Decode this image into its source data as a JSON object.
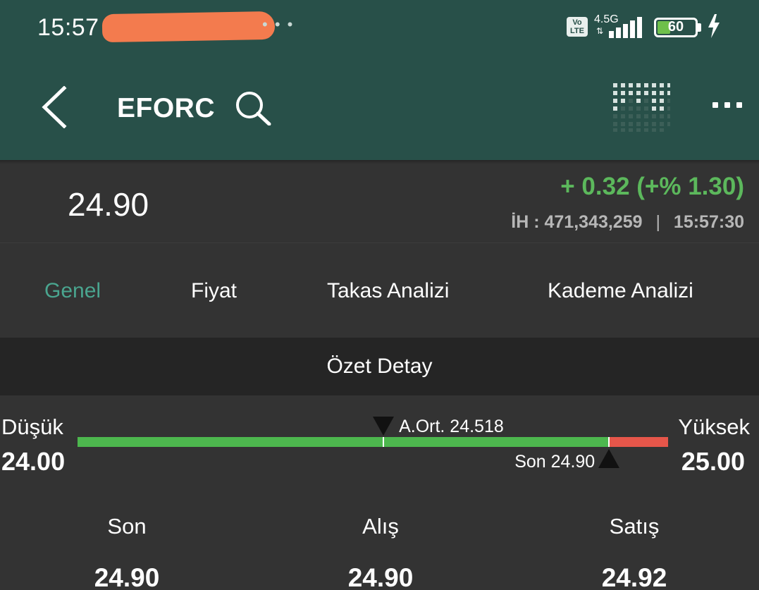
{
  "status_bar": {
    "time": "15:57",
    "network": "4.5G",
    "volte": "Vo\nLTE",
    "battery": "60"
  },
  "header": {
    "symbol": "EFORC",
    "icons": [
      "back-arrow-icon",
      "search-icon",
      "qr-code-icon",
      "more-options-icon"
    ]
  },
  "price": {
    "last": "24.90",
    "change": "+ 0.32 (+% 1.30)",
    "volume_label": "İH :",
    "volume_value": "471,343,259",
    "separator": "|",
    "time": "15:57:30",
    "change_color": "#5cb85c"
  },
  "tabs": [
    {
      "label": "Genel",
      "active": true
    },
    {
      "label": "Fiyat",
      "active": false
    },
    {
      "label": "Takas Analizi",
      "active": false
    },
    {
      "label": "Kademe Analizi",
      "active": false
    }
  ],
  "section": {
    "title": "Özet Detay"
  },
  "range": {
    "low_label": "Düşük",
    "low_value": "24.00",
    "high_label": "Yüksek",
    "high_value": "25.00",
    "low": 24.0,
    "high": 25.0,
    "average": 24.518,
    "average_label": "A.Ort. 24.518",
    "last": 24.9,
    "last_label": "Son 24.90",
    "green_color": "#4db74e",
    "red_color": "#e6564a"
  },
  "quote": {
    "last_label": "Son",
    "last_value": "24.90",
    "bid_label": "Alış",
    "bid_value": "24.90",
    "ask_label": "Satış",
    "ask_value": "24.92"
  },
  "theme": {
    "header_bg": "#285049",
    "content_bg": "#333333",
    "section_bg": "#252525",
    "accent": "#4aa58f"
  }
}
